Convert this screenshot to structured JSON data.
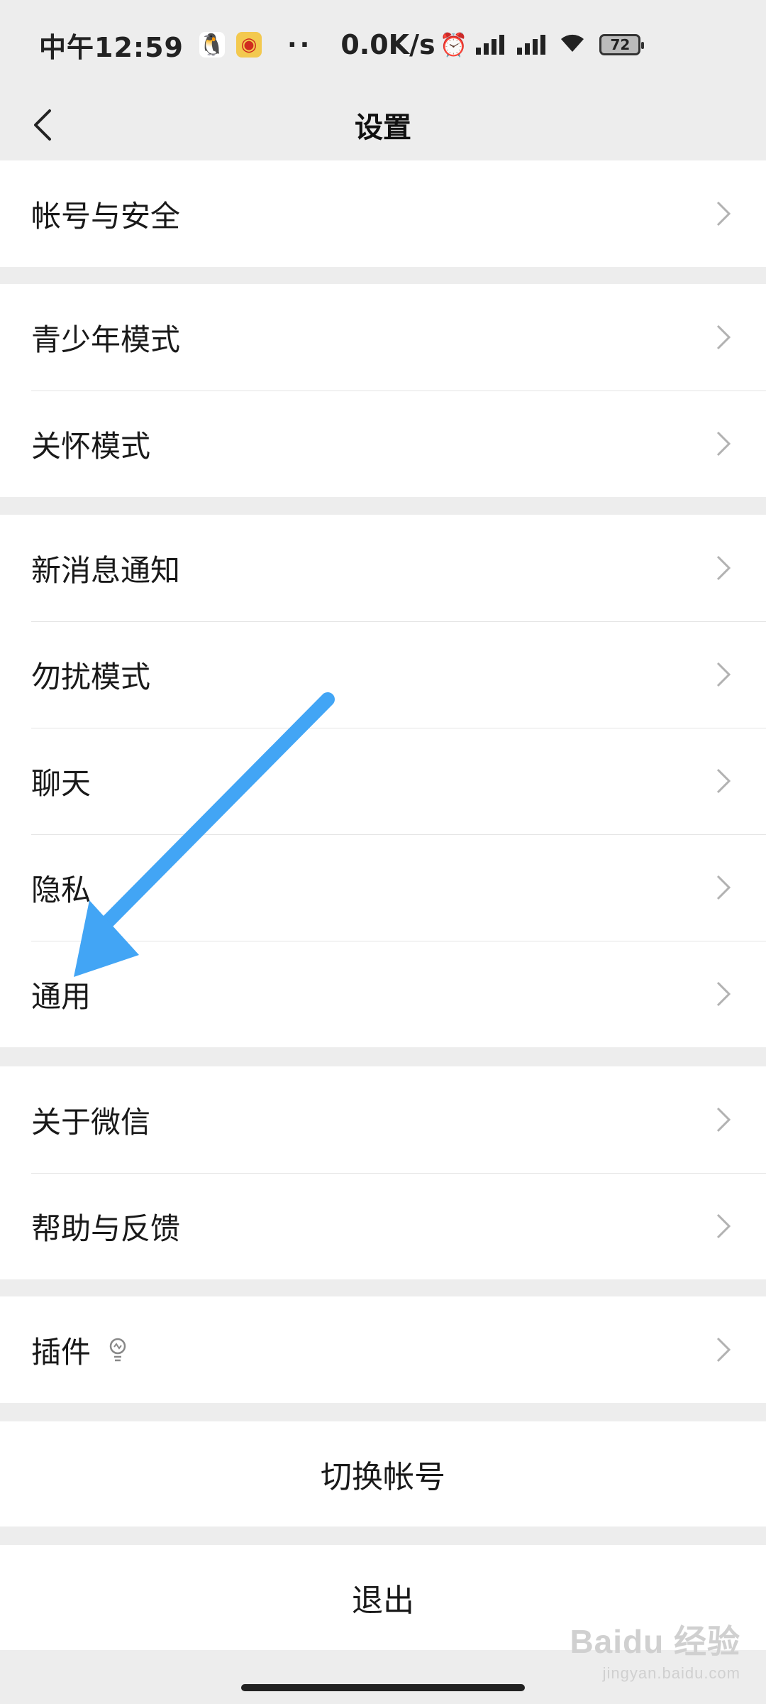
{
  "status_bar": {
    "time": "中午12:59",
    "net_speed": "0.0K/s",
    "battery": "72",
    "dots": "··"
  },
  "nav": {
    "title": "设置"
  },
  "groups": [
    {
      "items": [
        "帐号与安全"
      ]
    },
    {
      "items": [
        "青少年模式",
        "关怀模式"
      ]
    },
    {
      "items": [
        "新消息通知",
        "勿扰模式",
        "聊天",
        "隐私",
        "通用"
      ]
    },
    {
      "items": [
        "关于微信",
        "帮助与反馈"
      ]
    },
    {
      "items": [
        "插件"
      ]
    }
  ],
  "actions": {
    "switch_account": "切换帐号",
    "logout": "退出"
  },
  "watermark": {
    "brand": "Baidu 经验",
    "sub": "jingyan.baidu.com"
  },
  "colors": {
    "arrow": "#42a5f5",
    "background": "#ededed"
  }
}
